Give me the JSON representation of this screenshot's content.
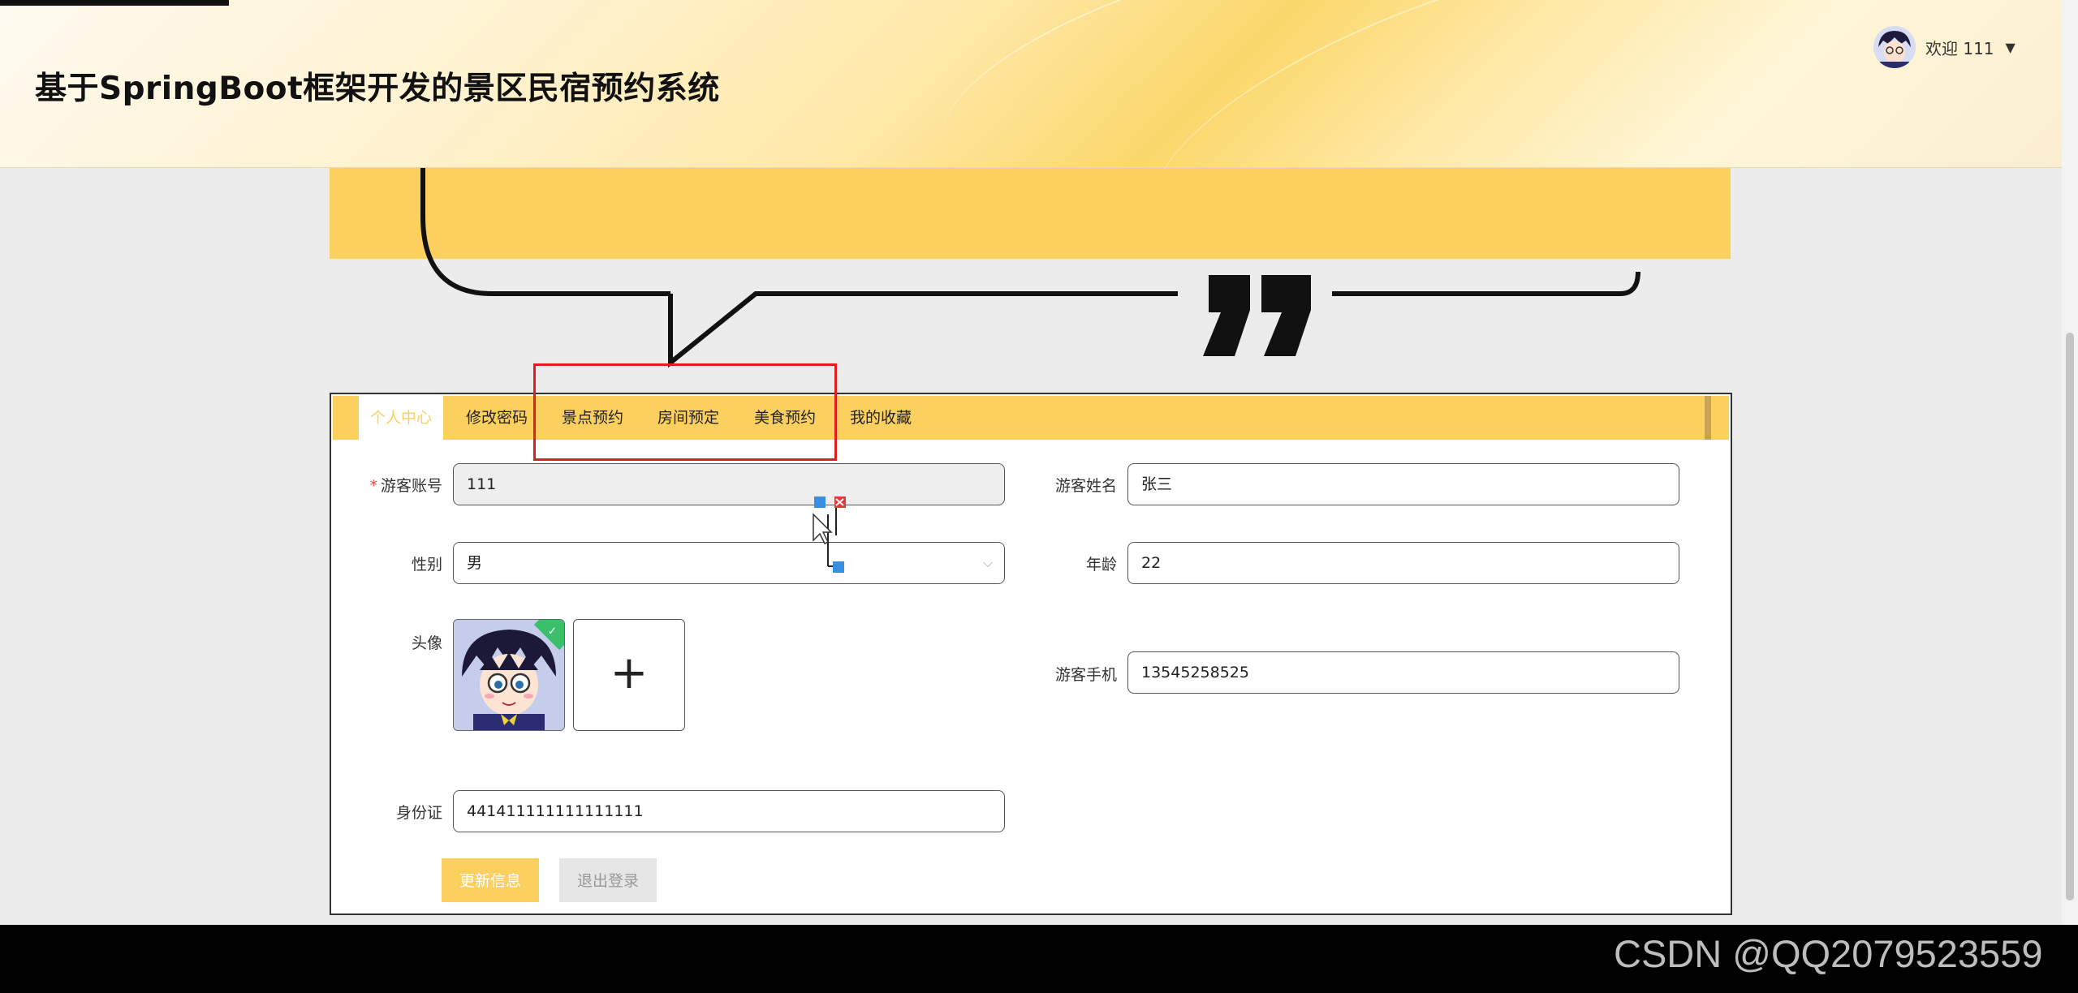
{
  "header": {
    "site_title": "基于SpringBoot框架开发的景区民宿预约系统",
    "welcome": "欢迎 111",
    "caret_icon": "caret-down-icon"
  },
  "tabs": [
    {
      "label": "个人中心",
      "active": true
    },
    {
      "label": "修改密码",
      "active": false
    },
    {
      "label": "景点预约",
      "active": false
    },
    {
      "label": "房间预定",
      "active": false
    },
    {
      "label": "美食预约",
      "active": false
    },
    {
      "label": "我的收藏",
      "active": false
    }
  ],
  "form": {
    "account_label": "游客账号",
    "account_required": "*",
    "account_value": "111",
    "name_label": "游客姓名",
    "name_value": "张三",
    "gender_label": "性别",
    "gender_value": "男",
    "age_label": "年龄",
    "age_value": "22",
    "avatar_label": "头像",
    "upload_symbol": "+",
    "phone_label": "游客手机",
    "phone_value": "13545258525",
    "idcard_label": "身份证",
    "idcard_value": "441411111111111111"
  },
  "buttons": {
    "update": "更新信息",
    "logout": "退出登录"
  },
  "watermark": "CSDN @QQ2079523559",
  "colors": {
    "accent": "#fcd05f",
    "highlight": "#e01e1e",
    "success": "#3bbf6a"
  }
}
